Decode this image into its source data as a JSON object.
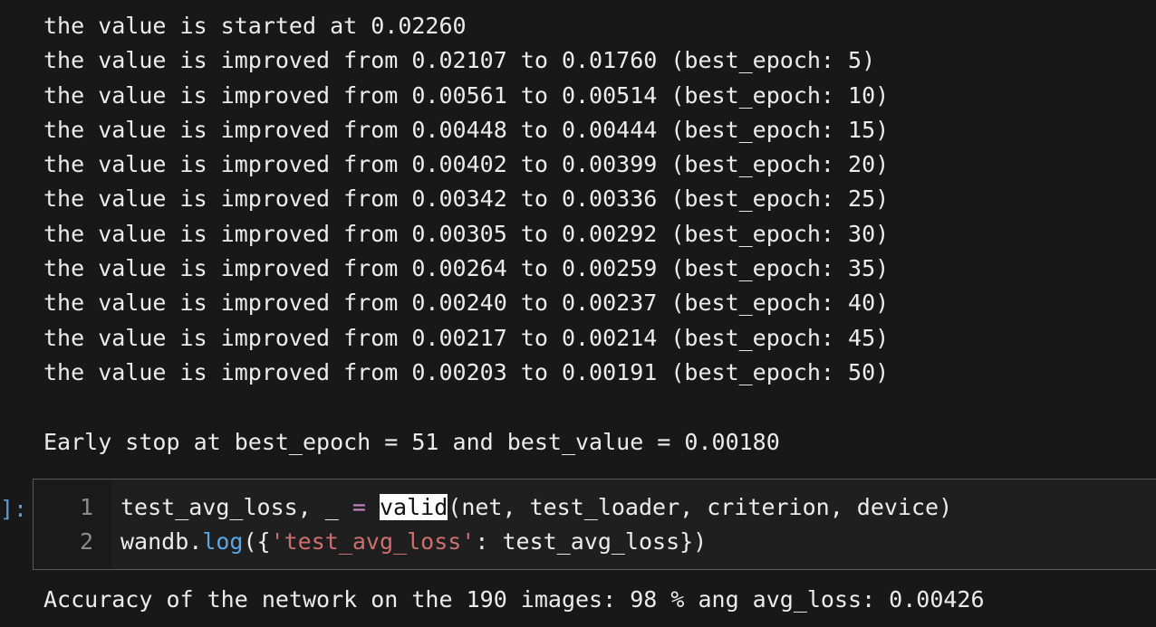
{
  "output": {
    "lines": [
      "the value is started at 0.02260",
      "the value is improved from 0.02107 to 0.01760 (best_epoch: 5)",
      "the value is improved from 0.00561 to 0.00514 (best_epoch: 10)",
      "the value is improved from 0.00448 to 0.00444 (best_epoch: 15)",
      "the value is improved from 0.00402 to 0.00399 (best_epoch: 20)",
      "the value is improved from 0.00342 to 0.00336 (best_epoch: 25)",
      "the value is improved from 0.00305 to 0.00292 (best_epoch: 30)",
      "the value is improved from 0.00264 to 0.00259 (best_epoch: 35)",
      "the value is improved from 0.00240 to 0.00237 (best_epoch: 40)",
      "the value is improved from 0.00217 to 0.00214 (best_epoch: 45)",
      "the value is improved from 0.00203 to 0.00191 (best_epoch: 50)"
    ],
    "early_stop": "Early stop at best_epoch = 51 and best_value = 0.00180"
  },
  "cell": {
    "prompt": "]:",
    "line_numbers": [
      "1",
      "2"
    ],
    "line1": {
      "prefix": "test_avg_loss, _ ",
      "op": "=",
      "space": " ",
      "highlight": "valid",
      "suffix": "(net, test_loader, criterion, device)"
    },
    "line2": {
      "obj": "wandb.",
      "fn": "log",
      "open": "({",
      "str": "'test_avg_loss'",
      "rest": ": test_avg_loss})"
    }
  },
  "result": "Accuracy of the network on the 190 images: 98 % ang avg_loss: 0.00426",
  "colors": {
    "background": "#181818",
    "text": "#ececec",
    "keyword_operator": "#c586c0",
    "function": "#5aa5e6",
    "string": "#ce6f6f",
    "line_number": "#8b8b8b"
  }
}
